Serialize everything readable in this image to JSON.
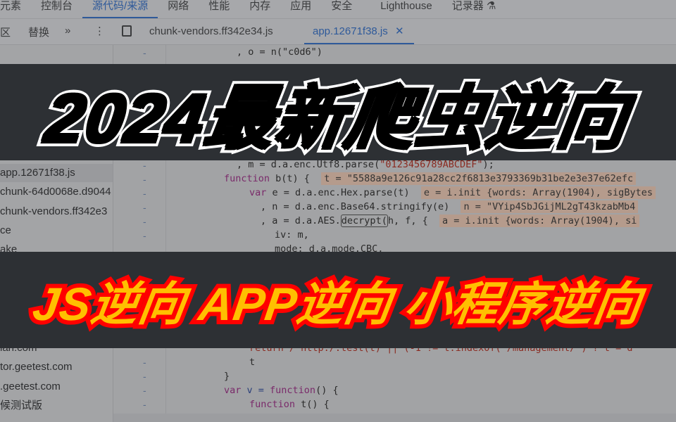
{
  "devtools": {
    "tabs": [
      "元素",
      "控制台",
      "源代码/来源",
      "网络",
      "性能",
      "内存",
      "应用",
      "安全",
      "Lighthouse",
      "记录器 ⚗"
    ],
    "active_tab": "源代码/来源",
    "subbar": {
      "left1": "区",
      "left2": "替换",
      "more": "»",
      "menu": "⋮",
      "files": [
        "chunk-vendors.ff342e34.js",
        "app.12671f38.js"
      ],
      "active_file": "app.12671f38.js",
      "close": "✕"
    },
    "sidebar": [
      "app.12671f38.js",
      "chunk-64d0068e.d9044",
      "chunk-vendors.ff342e3",
      "ce",
      "ake",
      "ian.com",
      "tor.geetest.com",
      ".geetest.com",
      "候测试版"
    ],
    "gutter_mark": "-",
    "code": {
      "l1": ", o = n(\"c0d6\")",
      "l2a": ", m = d.a.enc.Utf8.parse(",
      "l2b": "\"0123456789ABCDEF\"",
      "l2c": ");",
      "l3a": "function",
      "l3b": " b(t) {  ",
      "l3c": "t = \"5588a9e126c91a28cc2f6813e3793369b31be2e3e37e62efc",
      "l4a": "var",
      "l4b": " e = d.a.enc.Hex.parse(t)  ",
      "l4c": "e = i.init {words: Array(1904), sigBytes",
      "l5a": ", n = d.a.enc.Base64.stringify(e)  ",
      "l5b": "n = \"VYip4SbJGijML2gT43kzabMb4",
      "l6a": ", a = d.a.AES.",
      "l6b": "decrypt(",
      "l6c": "h, f, {  ",
      "l6d": "a = i.init {words: Array(1904), si",
      "l7": "iv: m,",
      "l8": "mode: d.a.mode.CBC,",
      "l9": "return /^http:/.test(t) || (-1 != t.indexOf(\"/management/\") ? t = d",
      "l10": "t",
      "l11": "}",
      "l12a": "var",
      "l12b": " v = ",
      "l12c": "function",
      "l12d": "() {",
      "l13a": "function",
      "l13b": " t() {"
    }
  },
  "banner": {
    "title": "2024最新爬虫逆向",
    "subtitle": "JS逆向 APP逆向 小程序逆向",
    "colors": {
      "title_fill": "#000000",
      "title_stroke": "#ffffff",
      "subtitle_fill": "#ffc000",
      "subtitle_stroke": "#ff0000",
      "band": "#2d3034"
    }
  }
}
